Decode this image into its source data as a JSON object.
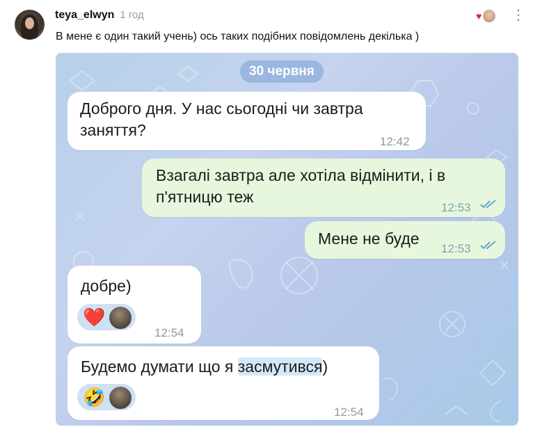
{
  "comment": {
    "username": "teya_elwyn",
    "time": "1 год",
    "text": "В мене є один такий учень) ось таких подібних повідомлень декілька )",
    "icons": {
      "avatar": "user-avatar",
      "reaction": "heart-icon",
      "more": "more-icon"
    },
    "more_glyph": "⋮"
  },
  "chat": {
    "date": "30 червня",
    "messages": [
      {
        "direction": "in",
        "lines": [
          "Доброго дня. У нас сьогодні чи завтра",
          "заняття?"
        ],
        "time": "12:42"
      },
      {
        "direction": "out",
        "lines": [
          "Взагалі завтра але хотіла відмінити, і в",
          "п'ятницю теж"
        ],
        "time": "12:53",
        "status": "read"
      },
      {
        "direction": "out",
        "lines": [
          "Мене не буде"
        ],
        "time": "12:53",
        "status": "read"
      },
      {
        "direction": "in",
        "lines": [
          "добре)"
        ],
        "time": "12:54",
        "reaction": {
          "emoji": "❤️",
          "icon": "heart-reaction-icon"
        }
      },
      {
        "direction": "in",
        "text_before": "Будемо думати що я ",
        "text_highlight": "засмутився",
        "text_after": ")",
        "time": "12:54",
        "reaction": {
          "emoji": "🤣",
          "icon": "rofl-reaction-icon"
        }
      }
    ]
  },
  "colors": {
    "read_check": "#5fa8c9",
    "highlight": "#d3e7f7",
    "heart": "#e02444"
  }
}
